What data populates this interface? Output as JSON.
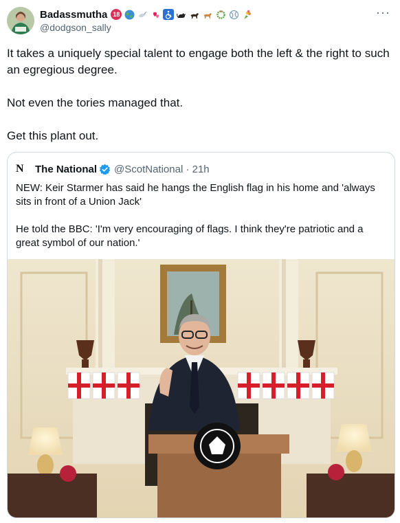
{
  "author": {
    "display_name": "Badassmutha",
    "handle": "@dodgson_sally",
    "avatar_icon": "avatar-photo",
    "badges": [
      "18-icon",
      "globe-icon",
      "dove-icon",
      "hearts-icon",
      "wheelchair-icon",
      "black-cat-icon",
      "dog-icon",
      "dog2-icon",
      "wreath-icon",
      "ball-icon",
      "bouquet-icon"
    ]
  },
  "more_label": "···",
  "tweet": {
    "paragraphs": [
      "It takes a uniquely special talent to engage both the left & the right to such an egregious degree.",
      "Not even the tories managed that.",
      "Get this plant out."
    ]
  },
  "quoted": {
    "logo_letter": "N",
    "name": "The National",
    "handle_time": "@ScotNational · 21h",
    "paragraphs": [
      "NEW: Keir Starmer has said he hangs the English flag in his home and 'always sits in front of a Union Jack'",
      "He told the BBC: 'I'm very encouraging of flags. I think they're patriotic and a great symbol of our nation.'"
    ]
  },
  "colors": {
    "text": "#0f1419",
    "secondary": "#536471",
    "border": "#cfd9de",
    "verified": "#1d9bf0"
  }
}
